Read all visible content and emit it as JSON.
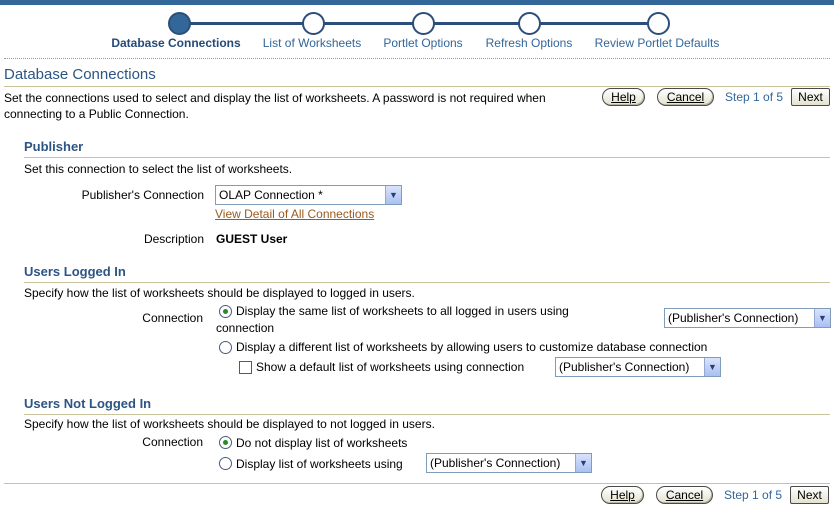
{
  "train": {
    "steps": [
      {
        "label": "Database Connections",
        "active": true
      },
      {
        "label": "List of Worksheets",
        "active": false
      },
      {
        "label": "Portlet Options",
        "active": false
      },
      {
        "label": "Refresh Options",
        "active": false
      },
      {
        "label": "Review Portlet Defaults",
        "active": false
      }
    ]
  },
  "page": {
    "title": "Database Connections",
    "instructions": "Set the connections used to select and display the list of worksheets. A password is not required when connecting to a Public Connection."
  },
  "nav": {
    "help": "Help",
    "cancel": "Cancel",
    "step": "Step 1 of 5",
    "next": "Next"
  },
  "publisher": {
    "title": "Publisher",
    "desc": "Set this connection to select the list of worksheets.",
    "connection_label": "Publisher's Connection",
    "connection_value": "OLAP Connection *",
    "detail_link": "View Detail of All Connections",
    "description_label": "Description",
    "description_value": "GUEST User"
  },
  "logged_in": {
    "title": "Users Logged In",
    "desc": "Specify how the list of worksheets should be displayed to logged in users.",
    "connection_label": "Connection",
    "option1_line1": "Display the same list of worksheets to all logged in users using",
    "option1_line2": "connection",
    "option1_select": "(Publisher's Connection)",
    "option2": "Display a different list of worksheets by allowing users to customize database connection",
    "checkbox_label": "Show a default list of worksheets using connection",
    "checkbox_select": "(Publisher's Connection)"
  },
  "not_logged_in": {
    "title": "Users Not Logged In",
    "desc": "Specify how the list of worksheets should be displayed to not logged in users.",
    "connection_label": "Connection",
    "option1": "Do not display list of worksheets",
    "option2": "Display list of worksheets using",
    "option2_select": "(Publisher's Connection)"
  },
  "colors": {
    "brand": "#336699",
    "title": "#2c5584",
    "link": "#9b5a1f"
  }
}
